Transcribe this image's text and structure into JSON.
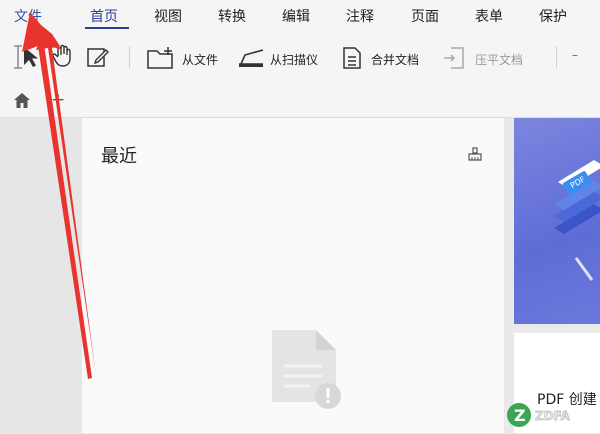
{
  "menubar": {
    "file": "文件",
    "tabs": [
      "首页",
      "视图",
      "转换",
      "编辑",
      "注释",
      "页面",
      "表单",
      "保护"
    ],
    "active_tab": "首页"
  },
  "toolbar": {
    "from_file": "从文件",
    "from_scanner": "从扫描仪",
    "merge_docs": "合并文档",
    "flatten_docs": "压平文档",
    "minimize_symbol": "–"
  },
  "tabstrip": {
    "add_symbol": "+"
  },
  "recent": {
    "title": "最近"
  },
  "promo": {
    "card_title": "PDF 创建",
    "badge_text": "PDF"
  },
  "watermark": {
    "text": "ZDFA"
  },
  "colors": {
    "accent": "#2b3e8f",
    "banner": "#6b79dc",
    "arrow": "#e8342e"
  }
}
